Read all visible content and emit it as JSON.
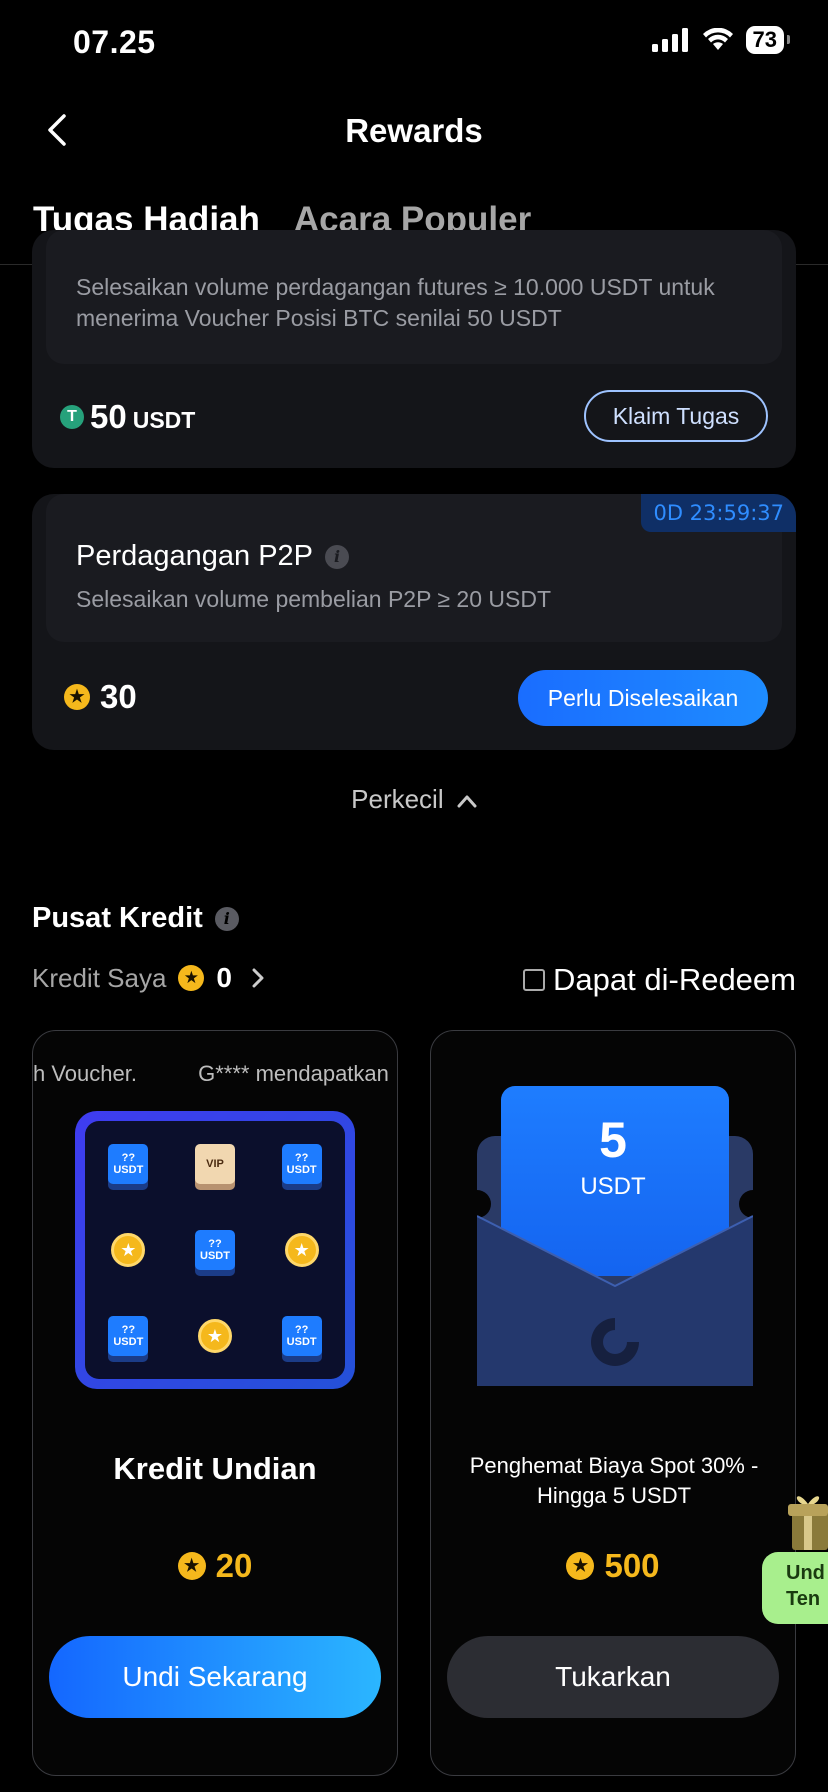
{
  "status_bar": {
    "time": "07.25",
    "battery": "73"
  },
  "header": {
    "title": "Rewards"
  },
  "tabs": [
    {
      "label": "Tugas Hadiah"
    },
    {
      "label": "Acara Populer"
    }
  ],
  "task1": {
    "description": "Selesaikan volume perdagangan futures ≥ 10.000 USDT untuk menerima Voucher Posisi BTC senilai 50 USDT",
    "reward_value": "50",
    "reward_unit": "USDT",
    "usdt_icon_text": "T",
    "button": "Klaim Tugas"
  },
  "task2": {
    "timer": "0D 23:59:37",
    "title": "Perdagangan P2P",
    "description": "Selesaikan volume pembelian P2P ≥ 20 USDT",
    "reward_value": "30",
    "button": "Perlu Diselesaikan"
  },
  "collapse_label": "Perkecil",
  "credit_center": {
    "title": "Pusat Kredit",
    "my_credit_label": "Kredit Saya",
    "my_credit_value": "0",
    "redeemable_label": "Dapat di-Redeem"
  },
  "prizes": [
    {
      "ticker": "h Voucher.          G**** mendapatkan",
      "name": "Kredit Undian",
      "cost": "20",
      "button": "Undi Sekarang",
      "grid_ticket_line1": "??",
      "grid_ticket_line2": "USDT",
      "grid_vip": "VIP"
    },
    {
      "voucher_amount": "5",
      "voucher_unit": "USDT",
      "name": "Penghemat Biaya Spot 30% - Hingga 5 USDT",
      "cost": "500",
      "button": "Tukarkan"
    }
  ],
  "floating_badge": {
    "line1": "Und",
    "line2": "Ten"
  },
  "colors": {
    "accent_blue": "#1a6dff",
    "star_gold": "#f5b81c",
    "usdt_green": "#26a17b",
    "badge_green": "#a8ef8d"
  }
}
